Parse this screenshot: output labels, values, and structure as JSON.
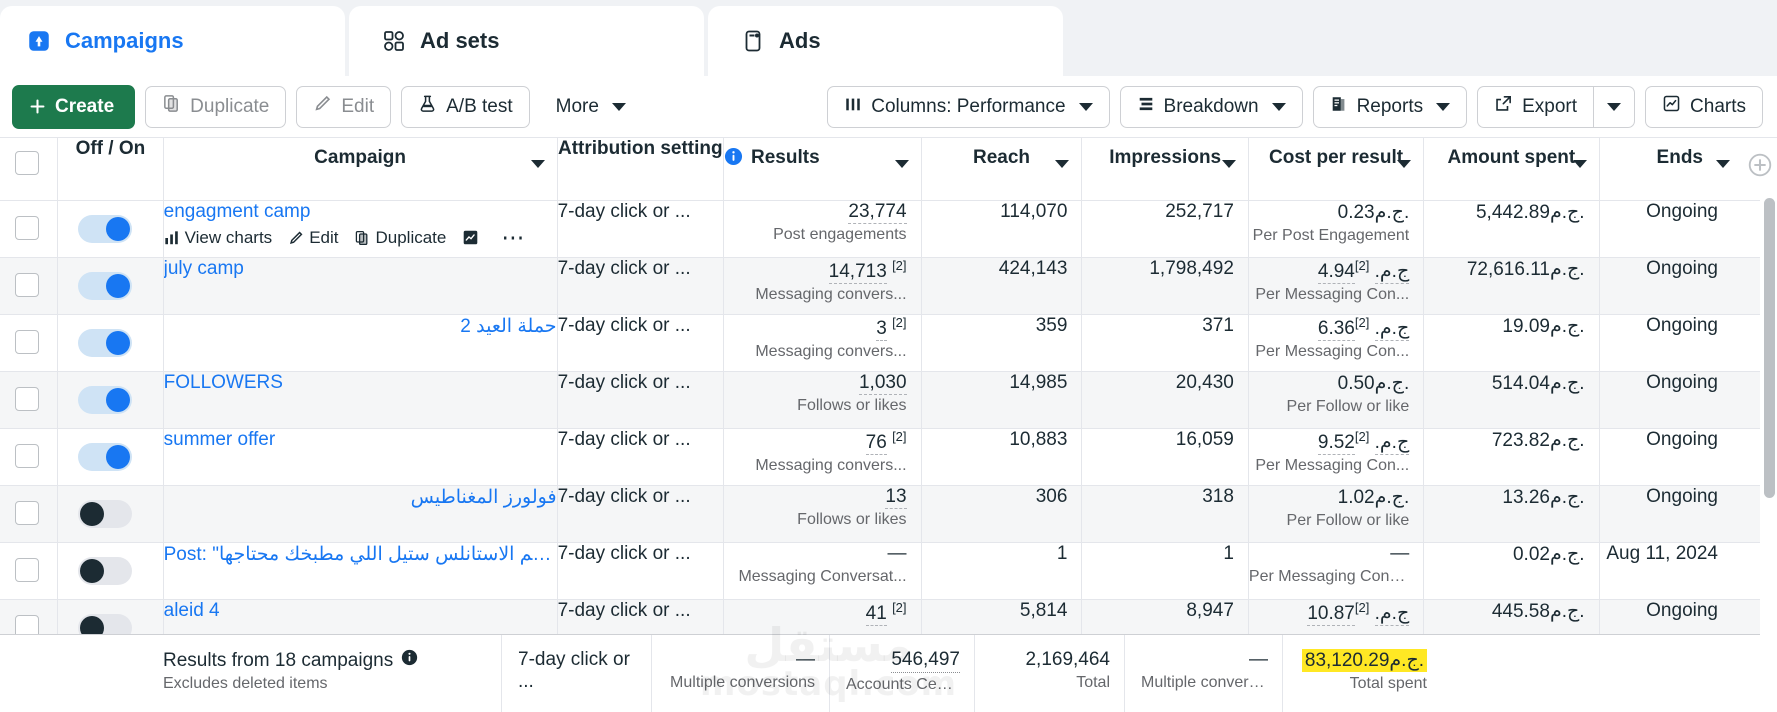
{
  "tabs": [
    {
      "label": "Campaigns",
      "icon": "campaign-flag-icon",
      "active": true
    },
    {
      "label": "Ad sets",
      "icon": "adsets-grid-icon",
      "active": false
    },
    {
      "label": "Ads",
      "icon": "ads-card-icon",
      "active": false
    }
  ],
  "toolbar": {
    "create_label": "Create",
    "duplicate_label": "Duplicate",
    "edit_label": "Edit",
    "abtest_label": "A/B test",
    "more_label": "More",
    "columns_label": "Columns: Performance",
    "breakdown_label": "Breakdown",
    "reports_label": "Reports",
    "export_label": "Export",
    "charts_label": "Charts"
  },
  "columns": [
    {
      "key": "checkbox",
      "label": ""
    },
    {
      "key": "offon",
      "label": "Off / On"
    },
    {
      "key": "campaign",
      "label": "Campaign"
    },
    {
      "key": "attribution",
      "label": "Attribution setting"
    },
    {
      "key": "results",
      "label": "Results"
    },
    {
      "key": "reach",
      "label": "Reach"
    },
    {
      "key": "impressions",
      "label": "Impressions"
    },
    {
      "key": "cpr",
      "label": "Cost per result"
    },
    {
      "key": "spent",
      "label": "Amount spent"
    },
    {
      "key": "ends",
      "label": "Ends"
    }
  ],
  "rows": [
    {
      "toggle": "on",
      "name": "engagment camp",
      "attribution": "7-day click or ...",
      "results": "23,774",
      "results_sup": "",
      "results_sub": "Post engagements",
      "reach": "114,070",
      "impressions": "252,717",
      "cpr": "0.23‏ج.م.",
      "cpr_sup": "",
      "cpr_sub": "Per Post Engagement",
      "spent": "5,442.89‏ج.م.",
      "ends": "Ongoing",
      "actions": [
        "View charts",
        "Edit",
        "Duplicate"
      ]
    },
    {
      "toggle": "on",
      "name": "july camp",
      "attribution": "7-day click or ...",
      "results": "14,713",
      "results_sup": "[2]",
      "results_sub": "Messaging convers...",
      "reach": "424,143",
      "impressions": "1,798,492",
      "cpr": "4.94‏ج.م.",
      "cpr_sup": "[2]",
      "cpr_sub": "Per Messaging Con...",
      "spent": "72,616.11‏ج.م.",
      "ends": "Ongoing",
      "actions": []
    },
    {
      "toggle": "on",
      "name": "حملة العيد 2",
      "attribution": "7-day click or ...",
      "results": "3",
      "results_sup": "[2]",
      "results_sub": "Messaging convers...",
      "reach": "359",
      "impressions": "371",
      "cpr": "6.36‏ج.م.",
      "cpr_sup": "[2]",
      "cpr_sub": "Per Messaging Con...",
      "spent": "19.09‏ج.م.",
      "ends": "Ongoing",
      "actions": []
    },
    {
      "toggle": "on",
      "name": "FOLLOWERS",
      "attribution": "7-day click or ...",
      "results": "1,030",
      "results_sup": "",
      "results_sub": "Follows or likes",
      "reach": "14,985",
      "impressions": "20,430",
      "cpr": "0.50‏ج.م.",
      "cpr_sup": "",
      "cpr_sub": "Per Follow or like",
      "spent": "514.04‏ج.م.",
      "ends": "Ongoing",
      "actions": []
    },
    {
      "toggle": "on",
      "name": "summer offer",
      "attribution": "7-day click or ...",
      "results": "76",
      "results_sup": "[2]",
      "results_sub": "Messaging convers...",
      "reach": "10,883",
      "impressions": "16,059",
      "cpr": "9.52‏ج.م.",
      "cpr_sup": "[2]",
      "cpr_sub": "Per Messaging Con...",
      "spent": "723.82‏ج.م.",
      "ends": "Ongoing",
      "actions": []
    },
    {
      "toggle": "off",
      "name": "فولورز المغناطيس",
      "attribution": "7-day click or ...",
      "results": "13",
      "results_sup": "",
      "results_sub": "Follows or likes",
      "reach": "306",
      "impressions": "318",
      "cpr": "1.02‏ج.م.",
      "cpr_sup": "",
      "cpr_sub": "Per Follow or like",
      "spent": "13.26‏ج.م.",
      "ends": "Ongoing",
      "actions": []
    },
    {
      "toggle": "off",
      "name": "Post: \"طقم الاستانلس ستيل اللي مطبخك محتاجها\\...",
      "attribution": "7-day click or ...",
      "results": "—",
      "results_sup": "",
      "results_sub": "Messaging Conversat...",
      "reach": "1",
      "impressions": "1",
      "cpr": "—",
      "cpr_sup": "",
      "cpr_sub": "Per Messaging Conve...",
      "spent": "0.02‏ج.م.",
      "ends": "Aug 11, 2024",
      "actions": []
    },
    {
      "toggle": "off",
      "name": "aleid 4",
      "attribution": "7-day click or ...",
      "results": "41",
      "results_sup": "[2]",
      "results_sub": "",
      "reach": "5,814",
      "impressions": "8,947",
      "cpr": "10.87‏ج.م.",
      "cpr_sup": "[2]",
      "cpr_sub": "",
      "spent": "445.58‏ج.م.",
      "ends": "Ongoing",
      "actions": []
    }
  ],
  "summary": {
    "title": "Results from 18 campaigns",
    "subtitle": "Excludes deleted items",
    "attribution": "7-day click or ...",
    "results": "—",
    "results_sub": "Multiple conversions",
    "reach": "546,497",
    "reach_sub": "Accounts Center acco...",
    "impressions": "2,169,464",
    "impressions_sub": "Total",
    "cpr": "—",
    "cpr_sub": "Multiple conversions",
    "spent": "83,120.29‏ج.م.",
    "spent_sub": "Total spent",
    "spent_highlight_color": "#ffe824"
  },
  "watermark": {
    "line1": "مستقل",
    "line2": "mostaql.com"
  },
  "colors": {
    "accent": "#1877f2",
    "create_green": "#1d7a4d",
    "highlight": "#ffe824"
  }
}
